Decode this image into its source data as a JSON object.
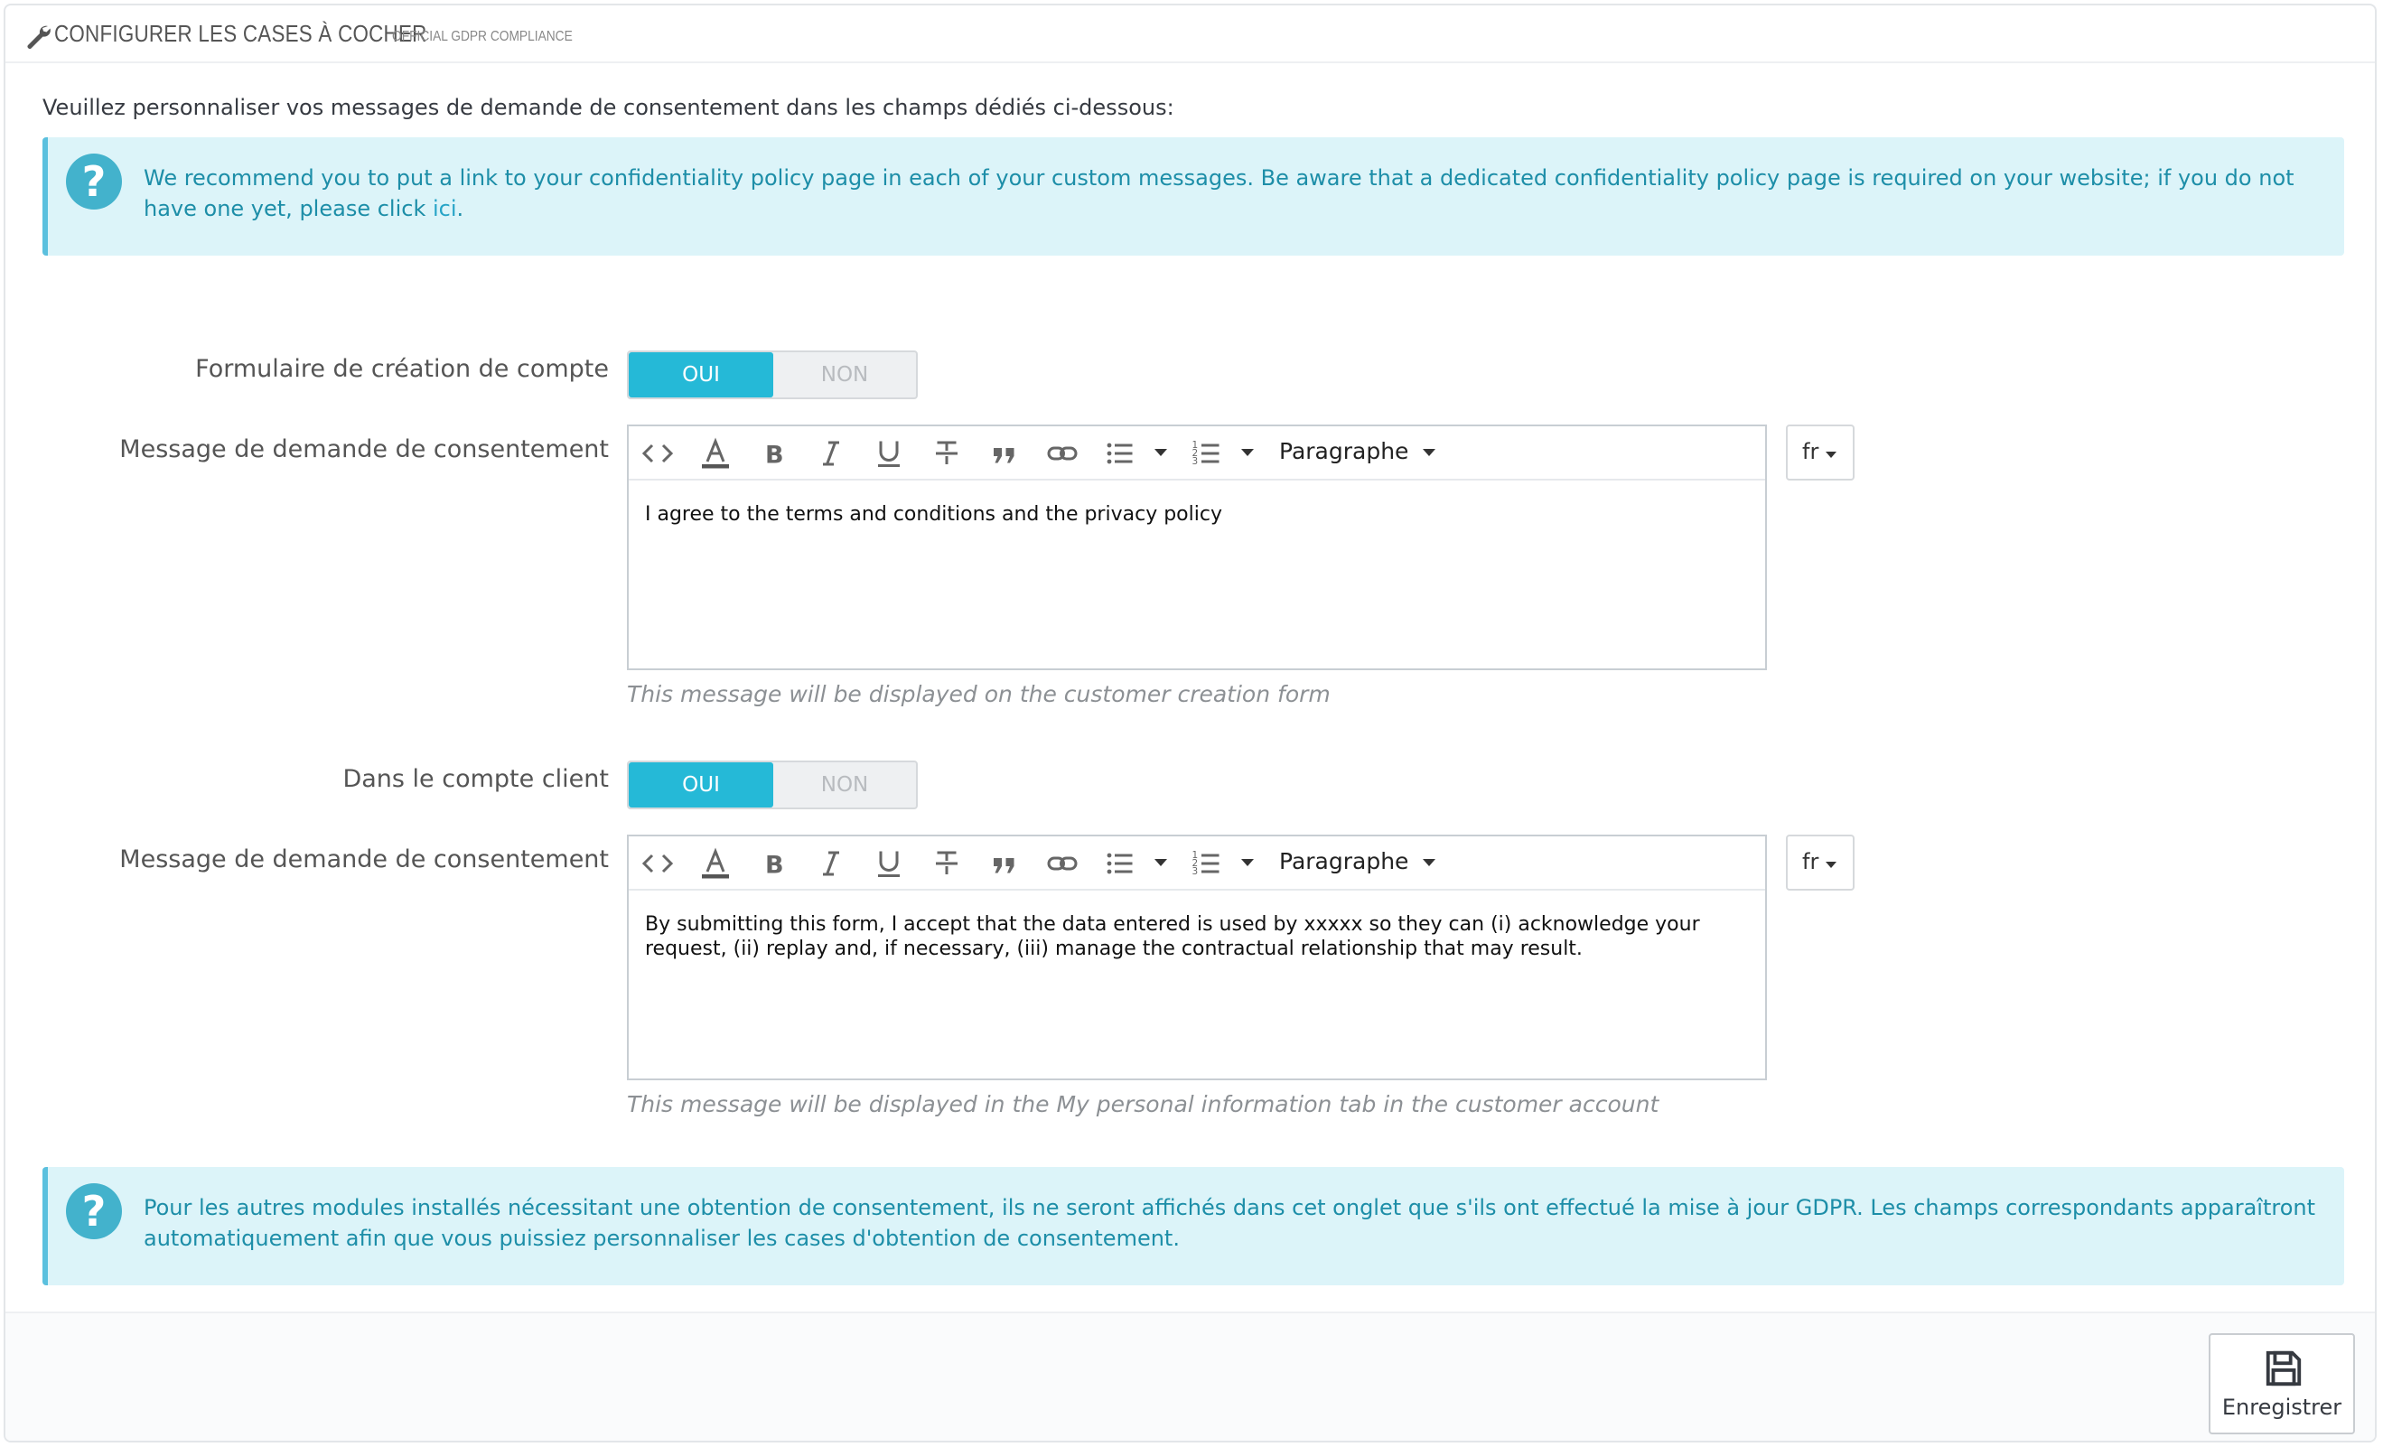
{
  "header": {
    "title": "CONFIGURER LES CASES À COCHER",
    "subtitle": "OFFICIAL GDPR COMPLIANCE",
    "icon": "wrench-icon"
  },
  "intro_text": "Veuillez personnaliser vos messages de demande de consentement dans les champs dédiés ci-dessous:",
  "alert_top": {
    "icon": "question-circle-icon",
    "text": "We recommend you to put a link to your confidentiality policy page in each of your custom messages. Be aware that a dedicated confidentiality policy page is required on your website; if you do not have one yet, please click ",
    "link_text": "ici",
    "suffix": "."
  },
  "section1": {
    "toggle_label": "Formulaire de création de compte",
    "toggle_on": "OUI",
    "toggle_off": "NON",
    "toggle_value": "OUI",
    "message_label": "Message de demande de consentement",
    "editor_text": "I agree to the terms and conditions and the privacy policy",
    "paragraph_select": "Paragraphe",
    "lang": "fr",
    "help": "This message will be displayed on the customer creation form"
  },
  "section2": {
    "toggle_label": "Dans le compte client",
    "toggle_on": "OUI",
    "toggle_off": "NON",
    "toggle_value": "OUI",
    "message_label": "Message de demande de consentement",
    "editor_text": "By submitting this form, I accept that the data entered is used by xxxxx so they can (i) acknowledge your request, (ii) replay and, if necessary, (iii) manage the contractual relationship that may result.",
    "paragraph_select": "Paragraphe",
    "lang": "fr",
    "help": "This message will be displayed in the My personal information tab in the customer account"
  },
  "alert_bottom": {
    "icon": "question-circle-icon",
    "text": "Pour les autres modules installés nécessitant une obtention de consentement, ils ne seront affichés dans cet onglet que s'ils ont effectué la mise à jour GDPR. Les champs correspondants apparaîtront automatiquement afin que vous puissiez personnaliser les cases d'obtention de consentement."
  },
  "footer": {
    "save_label": "Enregistrer",
    "save_icon": "floppy-disk-icon"
  },
  "colors": {
    "accent": "#25b9d7",
    "alert_bg": "#dcf4f9",
    "alert_border": "#5bc0de",
    "alert_text": "#1d8ea8"
  }
}
